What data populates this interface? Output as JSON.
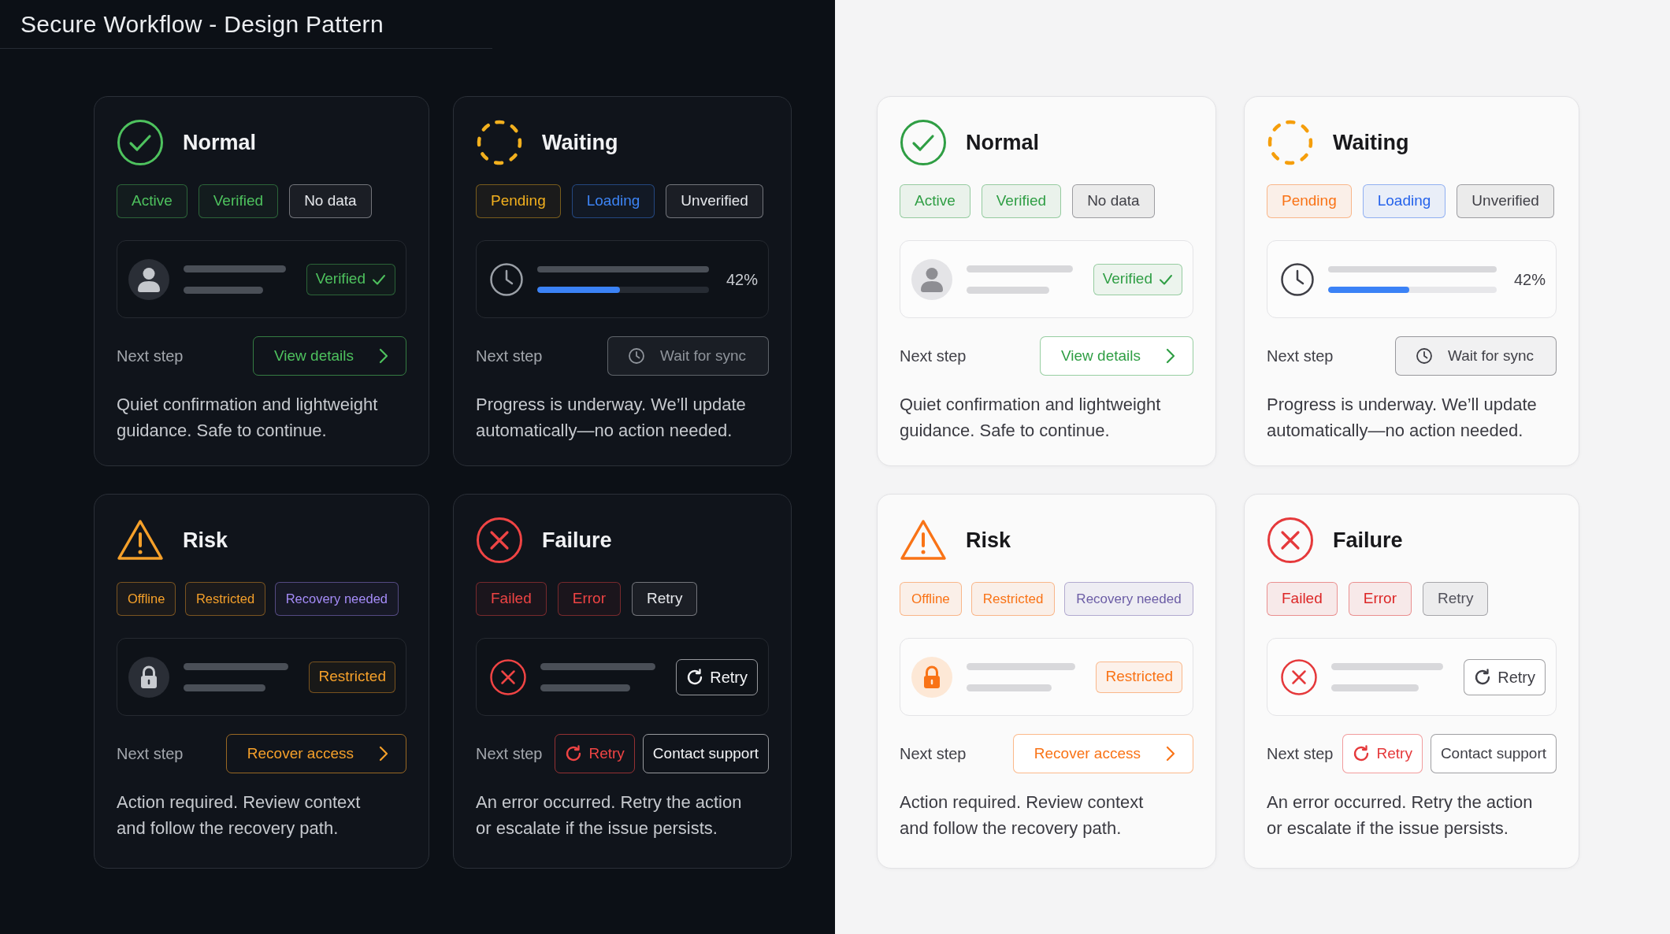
{
  "title": "Secure Workflow - Design Pattern",
  "panels": [
    {
      "kind": "dark",
      "cards": [
        {
          "kind": "success",
          "title": "Normal",
          "badges": [
            {
              "label": "Active",
              "color": "#4ec25e"
            },
            {
              "label": "Verified",
              "color": "#4ec25e"
            },
            {
              "label": "No data",
              "color": "#e5e7eb"
            }
          ],
          "detail": {
            "kind": "tag",
            "tag": {
              "label": "Verified",
              "kind": "check",
              "color": "#4ec25e"
            }
          },
          "next_step": "Next step",
          "actions": [
            {
              "label": "View details",
              "kind": "forward",
              "color": "#4ec25e",
              "disabled": false
            }
          ],
          "description": "Quiet confirmation and lightweight guidance. Safe to continue."
        },
        {
          "kind": "waiting",
          "title": "Waiting",
          "badges": [
            {
              "label": "Pending",
              "color": "#f2b01e"
            },
            {
              "label": "Loading",
              "color": "#3d84f5"
            },
            {
              "label": "Unverified",
              "color": "#e5e7eb"
            }
          ],
          "detail": {
            "kind": "progress",
            "level": 0.48,
            "reading": "42%"
          },
          "next_step": "Next step",
          "actions": [
            {
              "label": "Wait for sync",
              "kind": "wait",
              "color": "#8f949b",
              "disabled": true
            }
          ],
          "description": "Progress is underway. We’ll update automatically—no action needed."
        },
        {
          "kind": "warning",
          "title": "Risk",
          "badges": [
            {
              "label": "Offline",
              "color": "#f5a02a"
            },
            {
              "label": "Restricted",
              "color": "#f5a02a"
            },
            {
              "label": "Recovery needed",
              "color": "#a58cf8"
            }
          ],
          "detail": {
            "kind": "tag",
            "tag": {
              "label": "Restricted",
              "kind": "plain",
              "color": "#f5a02a"
            }
          },
          "next_step": "Next step",
          "actions": [
            {
              "label": "Recover access",
              "kind": "forward",
              "color": "#f5a02a",
              "disabled": false
            }
          ],
          "description": "Action required. Review context and follow the recovery path."
        },
        {
          "kind": "error",
          "title": "Failure",
          "badges": [
            {
              "label": "Failed",
              "color": "#ef4444"
            },
            {
              "label": "Error",
              "color": "#ef4444"
            },
            {
              "label": "Retry",
              "color": "#e5e7eb"
            }
          ],
          "detail": {
            "kind": "action",
            "action": {
              "label": "Retry",
              "kind": "retry",
              "color": "#f3f4f6",
              "disabled": false
            }
          },
          "next_step": "Next step",
          "actions": [
            {
              "label": "Retry",
              "kind": "retry",
              "color": "#ef4444",
              "disabled": false
            },
            {
              "label": "Contact support",
              "kind": "plain",
              "color": "#f3f4f6",
              "disabled": false
            }
          ],
          "description": "An error occurred. Retry the action or escalate if the issue persists."
        }
      ]
    },
    {
      "kind": "light",
      "cards": [
        {
          "kind": "success",
          "title": "Normal",
          "badges": [
            {
              "label": "Active",
              "color": "#2f9e44"
            },
            {
              "label": "Verified",
              "color": "#2f9e44"
            },
            {
              "label": "No data",
              "color": "#3f3f46"
            }
          ],
          "detail": {
            "kind": "tag",
            "tag": {
              "label": "Verified",
              "kind": "check",
              "color": "#2f9e44"
            }
          },
          "next_step": "Next step",
          "actions": [
            {
              "label": "View details",
              "kind": "forward",
              "color": "#2f9e44",
              "disabled": false
            }
          ],
          "description": "Quiet confirmation and lightweight guidance. Safe to continue."
        },
        {
          "kind": "waiting",
          "title": "Waiting",
          "badges": [
            {
              "label": "Pending",
              "color": "#f97316"
            },
            {
              "label": "Loading",
              "color": "#2563eb"
            },
            {
              "label": "Unverified",
              "color": "#3f3f46"
            }
          ],
          "detail": {
            "kind": "progress",
            "level": 0.48,
            "reading": "42%"
          },
          "next_step": "Next step",
          "actions": [
            {
              "label": "Wait for sync",
              "kind": "wait",
              "color": "#3f3f46",
              "disabled": true
            }
          ],
          "description": "Progress is underway. We’ll update automatically—no action needed."
        },
        {
          "kind": "warning",
          "title": "Risk",
          "badges": [
            {
              "label": "Offline",
              "color": "#f97316"
            },
            {
              "label": "Restricted",
              "color": "#f97316"
            },
            {
              "label": "Recovery needed",
              "color": "#6b5ca5"
            }
          ],
          "detail": {
            "kind": "tag",
            "tag": {
              "label": "Restricted",
              "kind": "plain",
              "color": "#f97316"
            }
          },
          "next_step": "Next step",
          "actions": [
            {
              "label": "Recover access",
              "kind": "forward",
              "color": "#f97316",
              "disabled": false
            }
          ],
          "description": "Action required. Review context and follow the recovery path."
        },
        {
          "kind": "error",
          "title": "Failure",
          "badges": [
            {
              "label": "Failed",
              "color": "#dc2626"
            },
            {
              "label": "Error",
              "color": "#dc2626"
            },
            {
              "label": "Retry",
              "color": "#52525b"
            }
          ],
          "detail": {
            "kind": "action",
            "action": {
              "label": "Retry",
              "kind": "retry",
              "color": "#3f3f46",
              "disabled": false
            }
          },
          "next_step": "Next step",
          "actions": [
            {
              "label": "Retry",
              "kind": "retry",
              "color": "#e5393b",
              "disabled": false
            },
            {
              "label": "Contact support",
              "kind": "plain",
              "color": "#3f3f46",
              "disabled": false
            }
          ],
          "description": "An error occurred. Retry the action or escalate if the issue persists."
        }
      ]
    }
  ]
}
